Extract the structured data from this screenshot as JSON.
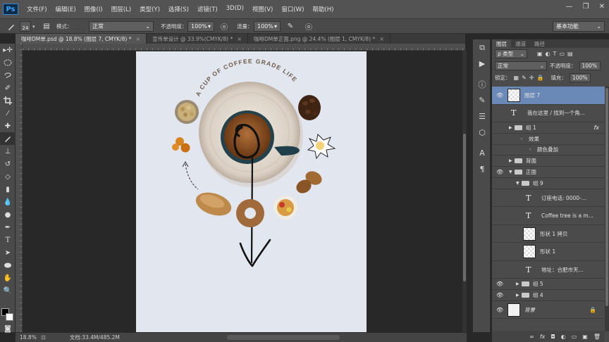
{
  "app": {
    "logo": "Ps"
  },
  "menu": [
    "文件(F)",
    "编辑(E)",
    "图像(I)",
    "图层(L)",
    "类型(Y)",
    "选择(S)",
    "滤镜(T)",
    "3D(D)",
    "视图(V)",
    "窗口(W)",
    "帮助(H)"
  ],
  "window_controls": [
    "—",
    "❐",
    "✕"
  ],
  "options_bar": {
    "brush_size": "24",
    "mode_label": "模式：",
    "mode_value": "正常",
    "opacity_label": "不透明度：",
    "opacity_value": "100%",
    "flow_label": "流量：",
    "flow_value": "100%",
    "workspace": "基本功能"
  },
  "tabs": [
    {
      "title": "咖啡DM单.psd @ 18.8% (图层 7, CMYK/8) *",
      "close": "×",
      "active": true
    },
    {
      "title": "宣传单设计 @ 33.9%(CMYK/8) *",
      "close": "×",
      "active": false
    },
    {
      "title": "咖啡DM单正面.png @ 24.4% (图层 1, CMYK/8) *",
      "close": "×",
      "active": false
    }
  ],
  "canvas": {
    "poster_text": "A CUP OF COFFEE GRADE LIFE",
    "background_color": "#e2e6ef",
    "annotation_color": "#111111"
  },
  "status": {
    "zoom": "18.8%",
    "doc_info": "文档:33.4M/485.2M"
  },
  "panel": {
    "tabs": [
      "图层",
      "通道",
      "路径"
    ],
    "filter_label": "ρ 类型",
    "blend_mode": "正常",
    "opacity_label": "不透明度：",
    "opacity_value": "100%",
    "lock_label": "锁定：",
    "fill_label": "填充：",
    "fill_value": "100%"
  },
  "layers": [
    {
      "name": "图层 7",
      "kind": "pixel",
      "visible": true,
      "selected": true
    },
    {
      "name": "我在这里 / 找到一个角...",
      "kind": "text",
      "visible": false
    },
    {
      "name": "组 1",
      "kind": "group",
      "visible": false,
      "fx": "fx",
      "collapsed": true
    },
    {
      "name": "效果",
      "kind": "effect",
      "visible": false
    },
    {
      "name": "颜色叠加",
      "kind": "effect-item",
      "visible": false
    },
    {
      "name": "背面",
      "kind": "group",
      "visible": false,
      "collapsed": true
    },
    {
      "name": "正面",
      "kind": "group",
      "visible": true,
      "collapsed": false
    },
    {
      "name": "组 9",
      "kind": "subgroup",
      "visible": false,
      "collapsed": false
    },
    {
      "name": "订座电话: 0000-...",
      "kind": "text",
      "visible": false
    },
    {
      "name": "Coffee tree is a m...",
      "kind": "textarea",
      "visible": false
    },
    {
      "name": "形状 1 拷贝",
      "kind": "shape",
      "visible": false
    },
    {
      "name": "形状 1",
      "kind": "shape",
      "visible": false
    },
    {
      "name": "地址：合肥市天...",
      "kind": "text",
      "visible": false
    },
    {
      "name": "组 5",
      "kind": "subgroup-closed",
      "visible": true
    },
    {
      "name": "组 4",
      "kind": "subgroup-closed",
      "visible": true
    },
    {
      "name": "背景",
      "kind": "background",
      "visible": true,
      "locked": true
    }
  ],
  "panel_bottom_icons": [
    "link-icon",
    "fx-icon",
    "mask-icon",
    "adjustment-icon",
    "folder-icon",
    "new-layer-icon",
    "trash-icon"
  ],
  "panel_bottom_glyphs": [
    "∞",
    "fx",
    "◘",
    "◐",
    "▭",
    "▣",
    "🗑"
  ]
}
